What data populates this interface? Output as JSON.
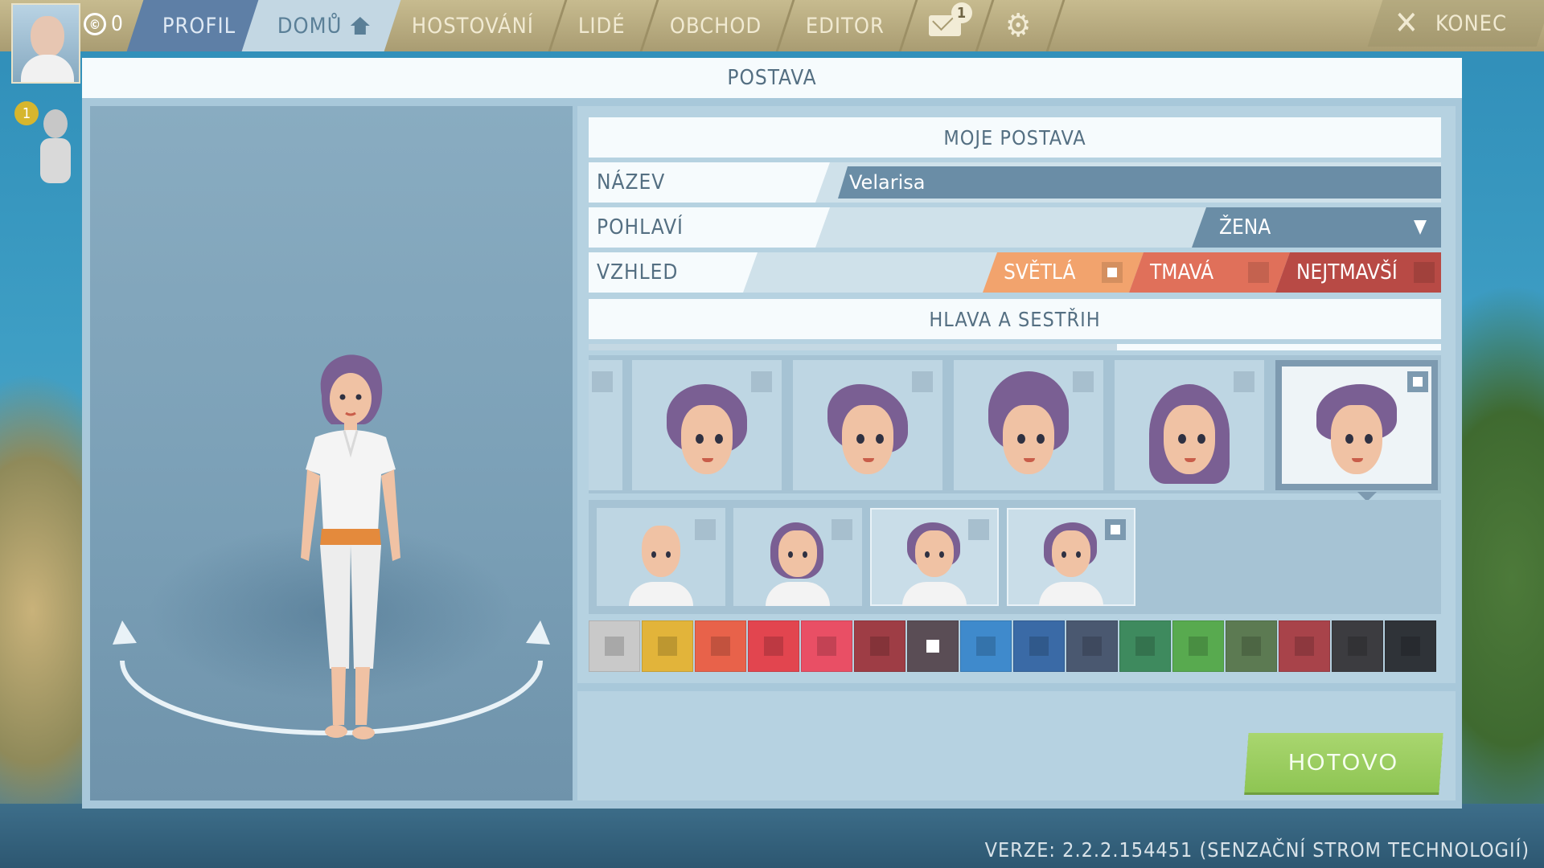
{
  "topbar": {
    "coins": "0",
    "tabs": [
      {
        "label": "PROFIL"
      },
      {
        "label": "DOMŮ"
      },
      {
        "label": "HOSTOVÁNÍ"
      },
      {
        "label": "LIDÉ"
      },
      {
        "label": "OBCHOD"
      },
      {
        "label": "EDITOR"
      }
    ],
    "mail_count": "1",
    "exit_label": "KONEC"
  },
  "sidebar": {
    "badge": "1"
  },
  "modal": {
    "title": "POSTAVA",
    "section_title": "MOJE POSTAVA",
    "name_label": "NÁZEV",
    "name_value": "Velarisa",
    "gender_label": "POHLAVÍ",
    "gender_value": "ŽENA",
    "appearance_label": "VZHLED",
    "skin_options": [
      {
        "label": "SVĚTLÁ",
        "selected": true,
        "color": "#f2a36d"
      },
      {
        "label": "TMAVÁ",
        "selected": false,
        "color": "#e0705a"
      },
      {
        "label": "NEJTMAVŠÍ",
        "selected": false,
        "color": "#b84a45"
      }
    ],
    "head_section_title": "HLAVA A SESTŘIH",
    "scroll_progress": 0.38,
    "done_label": "HOTOVO"
  },
  "colors": {
    "swatches": [
      "#c9c9c9",
      "#e2b43a",
      "#e8624a",
      "#e2454f",
      "#e94f65",
      "#9e3d45",
      "#5a4d55",
      "#3f8acc",
      "#3a6aa6",
      "#4a5870",
      "#3e8a5e",
      "#58aa4f",
      "#5c7a52",
      "#a8434a",
      "#3c3c40",
      "#2f3338"
    ],
    "selected_index": 6
  },
  "version": "VERZE: 2.2.2.154451 (SENZAČNÍ STROM TECHNOLOGIÍ)"
}
